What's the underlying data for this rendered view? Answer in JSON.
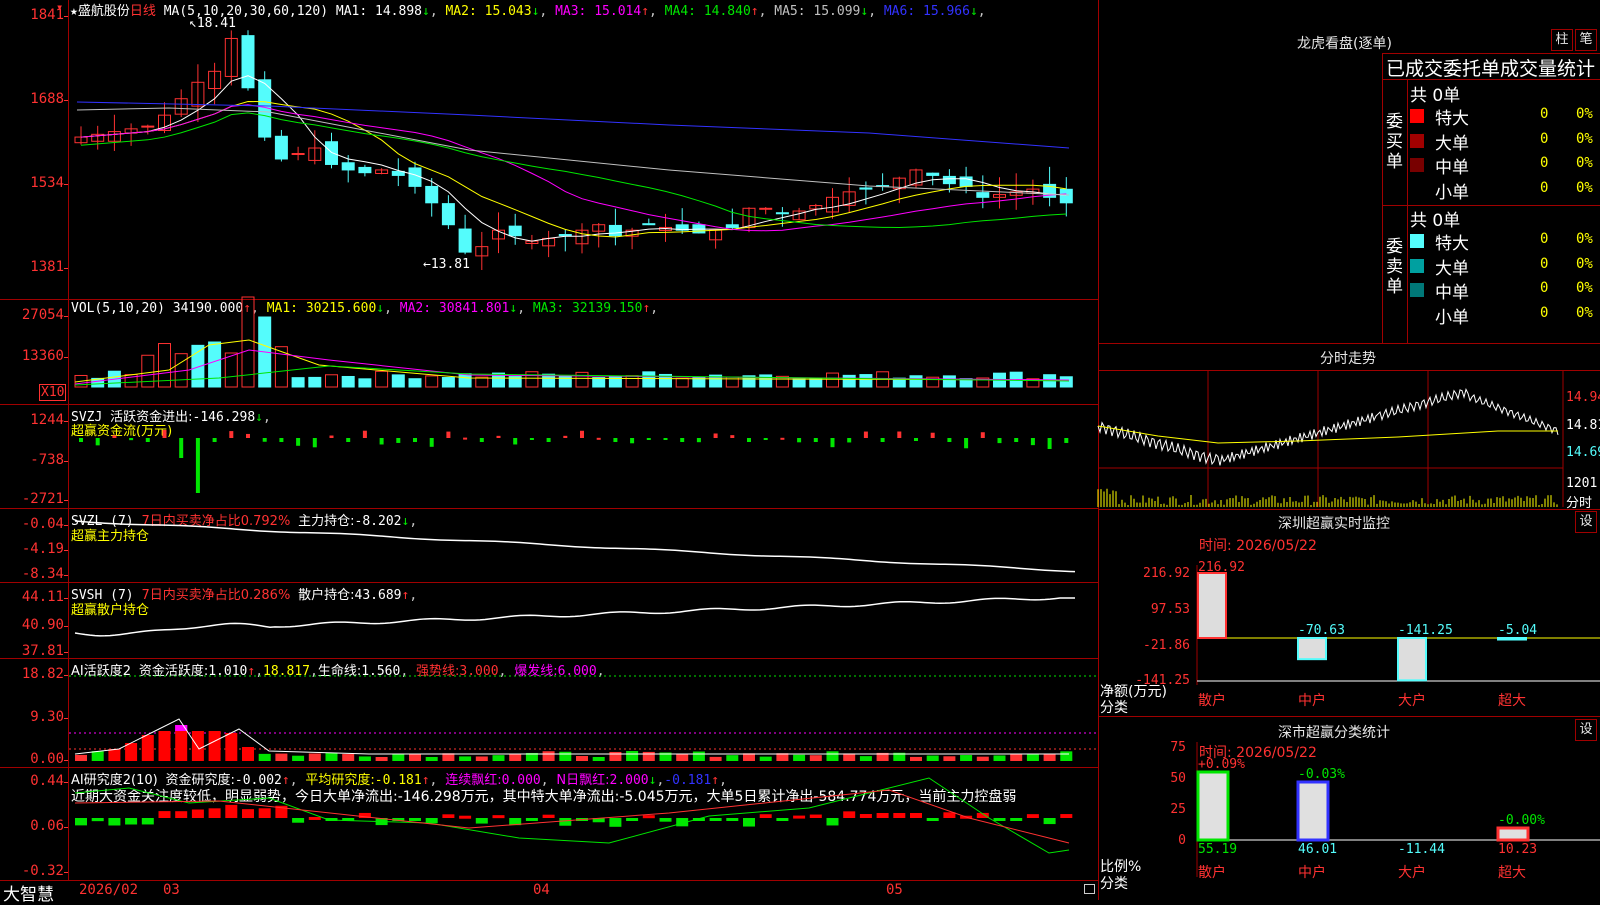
{
  "stock": {
    "name": "盛航股份",
    "period": "日线",
    "star": "★"
  },
  "kline": {
    "ma_header": "MA(5,10,20,30,60,120)",
    "ma": [
      {
        "label": "MA1:",
        "value": "14.898",
        "arrow": "↓",
        "color": "#ffffff"
      },
      {
        "label": "MA2:",
        "value": "15.043",
        "arrow": "↓",
        "color": "#ffff00"
      },
      {
        "label": "MA3:",
        "value": "15.014",
        "arrow": "↑",
        "color": "#ff00ff"
      },
      {
        "label": "MA4:",
        "value": "14.840",
        "arrow": "↑",
        "color": "#00e600"
      },
      {
        "label": "MA5:",
        "value": "15.099",
        "arrow": "↓",
        "color": "#c0c0c0"
      },
      {
        "label": "MA6:",
        "value": "15.966",
        "arrow": "↓",
        "color": "#3232ff"
      }
    ],
    "yticks": [
      "1841",
      "1688",
      "1534",
      "1381"
    ],
    "high_label": "18.41",
    "low_label": "13.81"
  },
  "vol": {
    "header": "VOL(5,10,20)",
    "value": "34190.000",
    "ma": [
      {
        "label": "MA1:",
        "value": "30215.600",
        "arrow": "↓",
        "color": "#ffff00"
      },
      {
        "label": "MA2:",
        "value": "30841.801",
        "arrow": "↓",
        "color": "#ff00ff"
      },
      {
        "label": "MA3:",
        "value": "32139.150",
        "arrow": "↑",
        "color": "#00e600"
      }
    ],
    "yticks": [
      "27054",
      "13360"
    ],
    "unit": "X10"
  },
  "svzj": {
    "header": "SVZJ",
    "title": "活跃资金进出:",
    "value": "-146.298",
    "arrow": "↓",
    "subtitle": "超赢资金流(万元)",
    "yticks": [
      "1244",
      "-738",
      "-2721"
    ]
  },
  "svzl": {
    "header": "SVZL (7)",
    "ratio_label": "7日内买卖净占比0.792%",
    "hold_label": "主力持仓:",
    "hold_value": "-8.202",
    "arrow": "↓",
    "subtitle": "超赢主力持仓",
    "yticks": [
      "-0.04",
      "-4.19",
      "-8.34"
    ]
  },
  "svsh": {
    "header": "SVSH (7)",
    "ratio_label": "7日内买卖净占比0.286%",
    "hold_label": "散户持仓:",
    "hold_value": "43.689",
    "arrow": "↑",
    "subtitle": "超赢散户持仓",
    "yticks": [
      "44.11",
      "40.90",
      "37.81"
    ]
  },
  "ai_active": {
    "header": "AI活跃度2",
    "label": "资金活跃度:",
    "value": "1.010",
    "arrow": "↑",
    "value2": "18.817",
    "life_label": "生命线:",
    "life_value": "1.560",
    "strong_label": "强势线:",
    "strong_value": "3.000",
    "burst_label": "爆发线:",
    "burst_value": "6.000",
    "yticks": [
      "18.82",
      "9.30",
      "0.00"
    ]
  },
  "ai_research": {
    "header": "AI研究度2(10)",
    "label": "资金研究度:",
    "value": "-0.002",
    "arrow": "↑",
    "avg_label": "平均研究度:",
    "avg_value": "-0.181",
    "cont_label": "连续飘红:",
    "cont_value": "0.000",
    "n_label": "N日飘红:",
    "n_value": "2.000",
    "n_arrow": "↓",
    "last_value": "-0.181",
    "last_arrow": "↑",
    "comment": "近期大资金关注度较低，明显弱势，今日大单净流出:-146.298万元，其中特大单净流出:-5.045万元，大单5日累计净出-584.774万元，当前主力控盘弱",
    "yticks": [
      "0.44",
      "0.06",
      "-0.32"
    ]
  },
  "bottom": {
    "brand": "大智慧",
    "dates": [
      "2026/02",
      "03",
      "04",
      "05"
    ]
  },
  "right": {
    "longhu_title": "龙虎看盘(逐单)",
    "btn_bar": "柱",
    "btn_bi": "笔",
    "tabs_title": "已成交委托单成交量统计",
    "buy": {
      "side": "委买单",
      "total": "共 0单",
      "rows": [
        {
          "label": "特大",
          "count": "0",
          "pct": "0%",
          "color": "#ff0000"
        },
        {
          "label": "大单",
          "count": "0",
          "pct": "0%",
          "color": "#a00000"
        },
        {
          "label": "中单",
          "count": "0",
          "pct": "0%",
          "color": "#780000"
        },
        {
          "label": "小单",
          "count": "0",
          "pct": "0%",
          "color": ""
        }
      ]
    },
    "sell": {
      "side": "委卖单",
      "total": "共 0单",
      "rows": [
        {
          "label": "特大",
          "count": "0",
          "pct": "0%",
          "color": "#54fcfc"
        },
        {
          "label": "大单",
          "count": "0",
          "pct": "0%",
          "color": "#00a0a0"
        },
        {
          "label": "中单",
          "count": "0",
          "pct": "0%",
          "color": "#007878"
        },
        {
          "label": "小单",
          "count": "0",
          "pct": "0%",
          "color": ""
        }
      ]
    },
    "intraday": {
      "title": "分时走势",
      "yticks": [
        "14.94",
        "14.81",
        "14.69"
      ],
      "vol_tick": "1201",
      "vol_label": "分时"
    },
    "sz_monitor": {
      "title": "深圳超赢实时监控",
      "btn": "设",
      "time": "时间: 2026/05/22",
      "yticks": [
        "216.92",
        "97.53",
        "-21.86",
        "-141.25"
      ],
      "ylabel1": "净额(万元)",
      "ylabel2": "分类",
      "cats": [
        "散户",
        "中户",
        "大户",
        "超大"
      ],
      "values": [
        "216.92",
        "-70.63",
        "-141.25",
        "-5.04"
      ]
    },
    "sz_class": {
      "title": "深市超赢分类统计",
      "btn": "设",
      "time": "时间: 2026/05/22",
      "yticks": [
        "75",
        "50",
        "25",
        "0"
      ],
      "ylabel1": "比例%",
      "ylabel2": "分类",
      "cats": [
        "散户",
        "中户",
        "大户",
        "超大"
      ],
      "top_labels": [
        "+0.09%",
        "-0.03%",
        "",
        "-0.00%"
      ],
      "values": [
        "55.19",
        "46.01",
        "-11.44",
        "10.23"
      ]
    }
  },
  "colors": {
    "up": "#ff3232",
    "down": "#54fcfc",
    "frame": "#a00000"
  }
}
